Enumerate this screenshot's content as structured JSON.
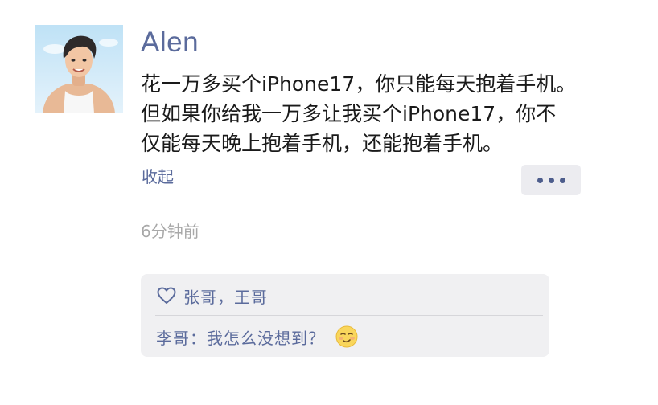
{
  "post": {
    "username": "Alen",
    "text_lines": [
      "花一万多买个iPhone17，你只能每天抱着手机。",
      "但如果你给我一万多让我买个iPhone17，你不",
      "仅能每天晚上抱着手机，还能抱着手机。"
    ],
    "collapse_label": "收起",
    "timestamp": "6分钟前",
    "more_icon": "ellipsis-icon",
    "avatar_icon": "user-avatar"
  },
  "interactions": {
    "like_icon": "heart-outline-icon",
    "likes": "张哥，王哥",
    "comments": [
      {
        "author": "李哥：",
        "text": "我怎么没想到？",
        "emoji_icon": "smirk-emoji-icon"
      }
    ]
  },
  "colors": {
    "link": "#5b6b9c",
    "text": "#1a1a1a",
    "muted": "#a8a8a8",
    "panel": "#f0f0f2"
  }
}
